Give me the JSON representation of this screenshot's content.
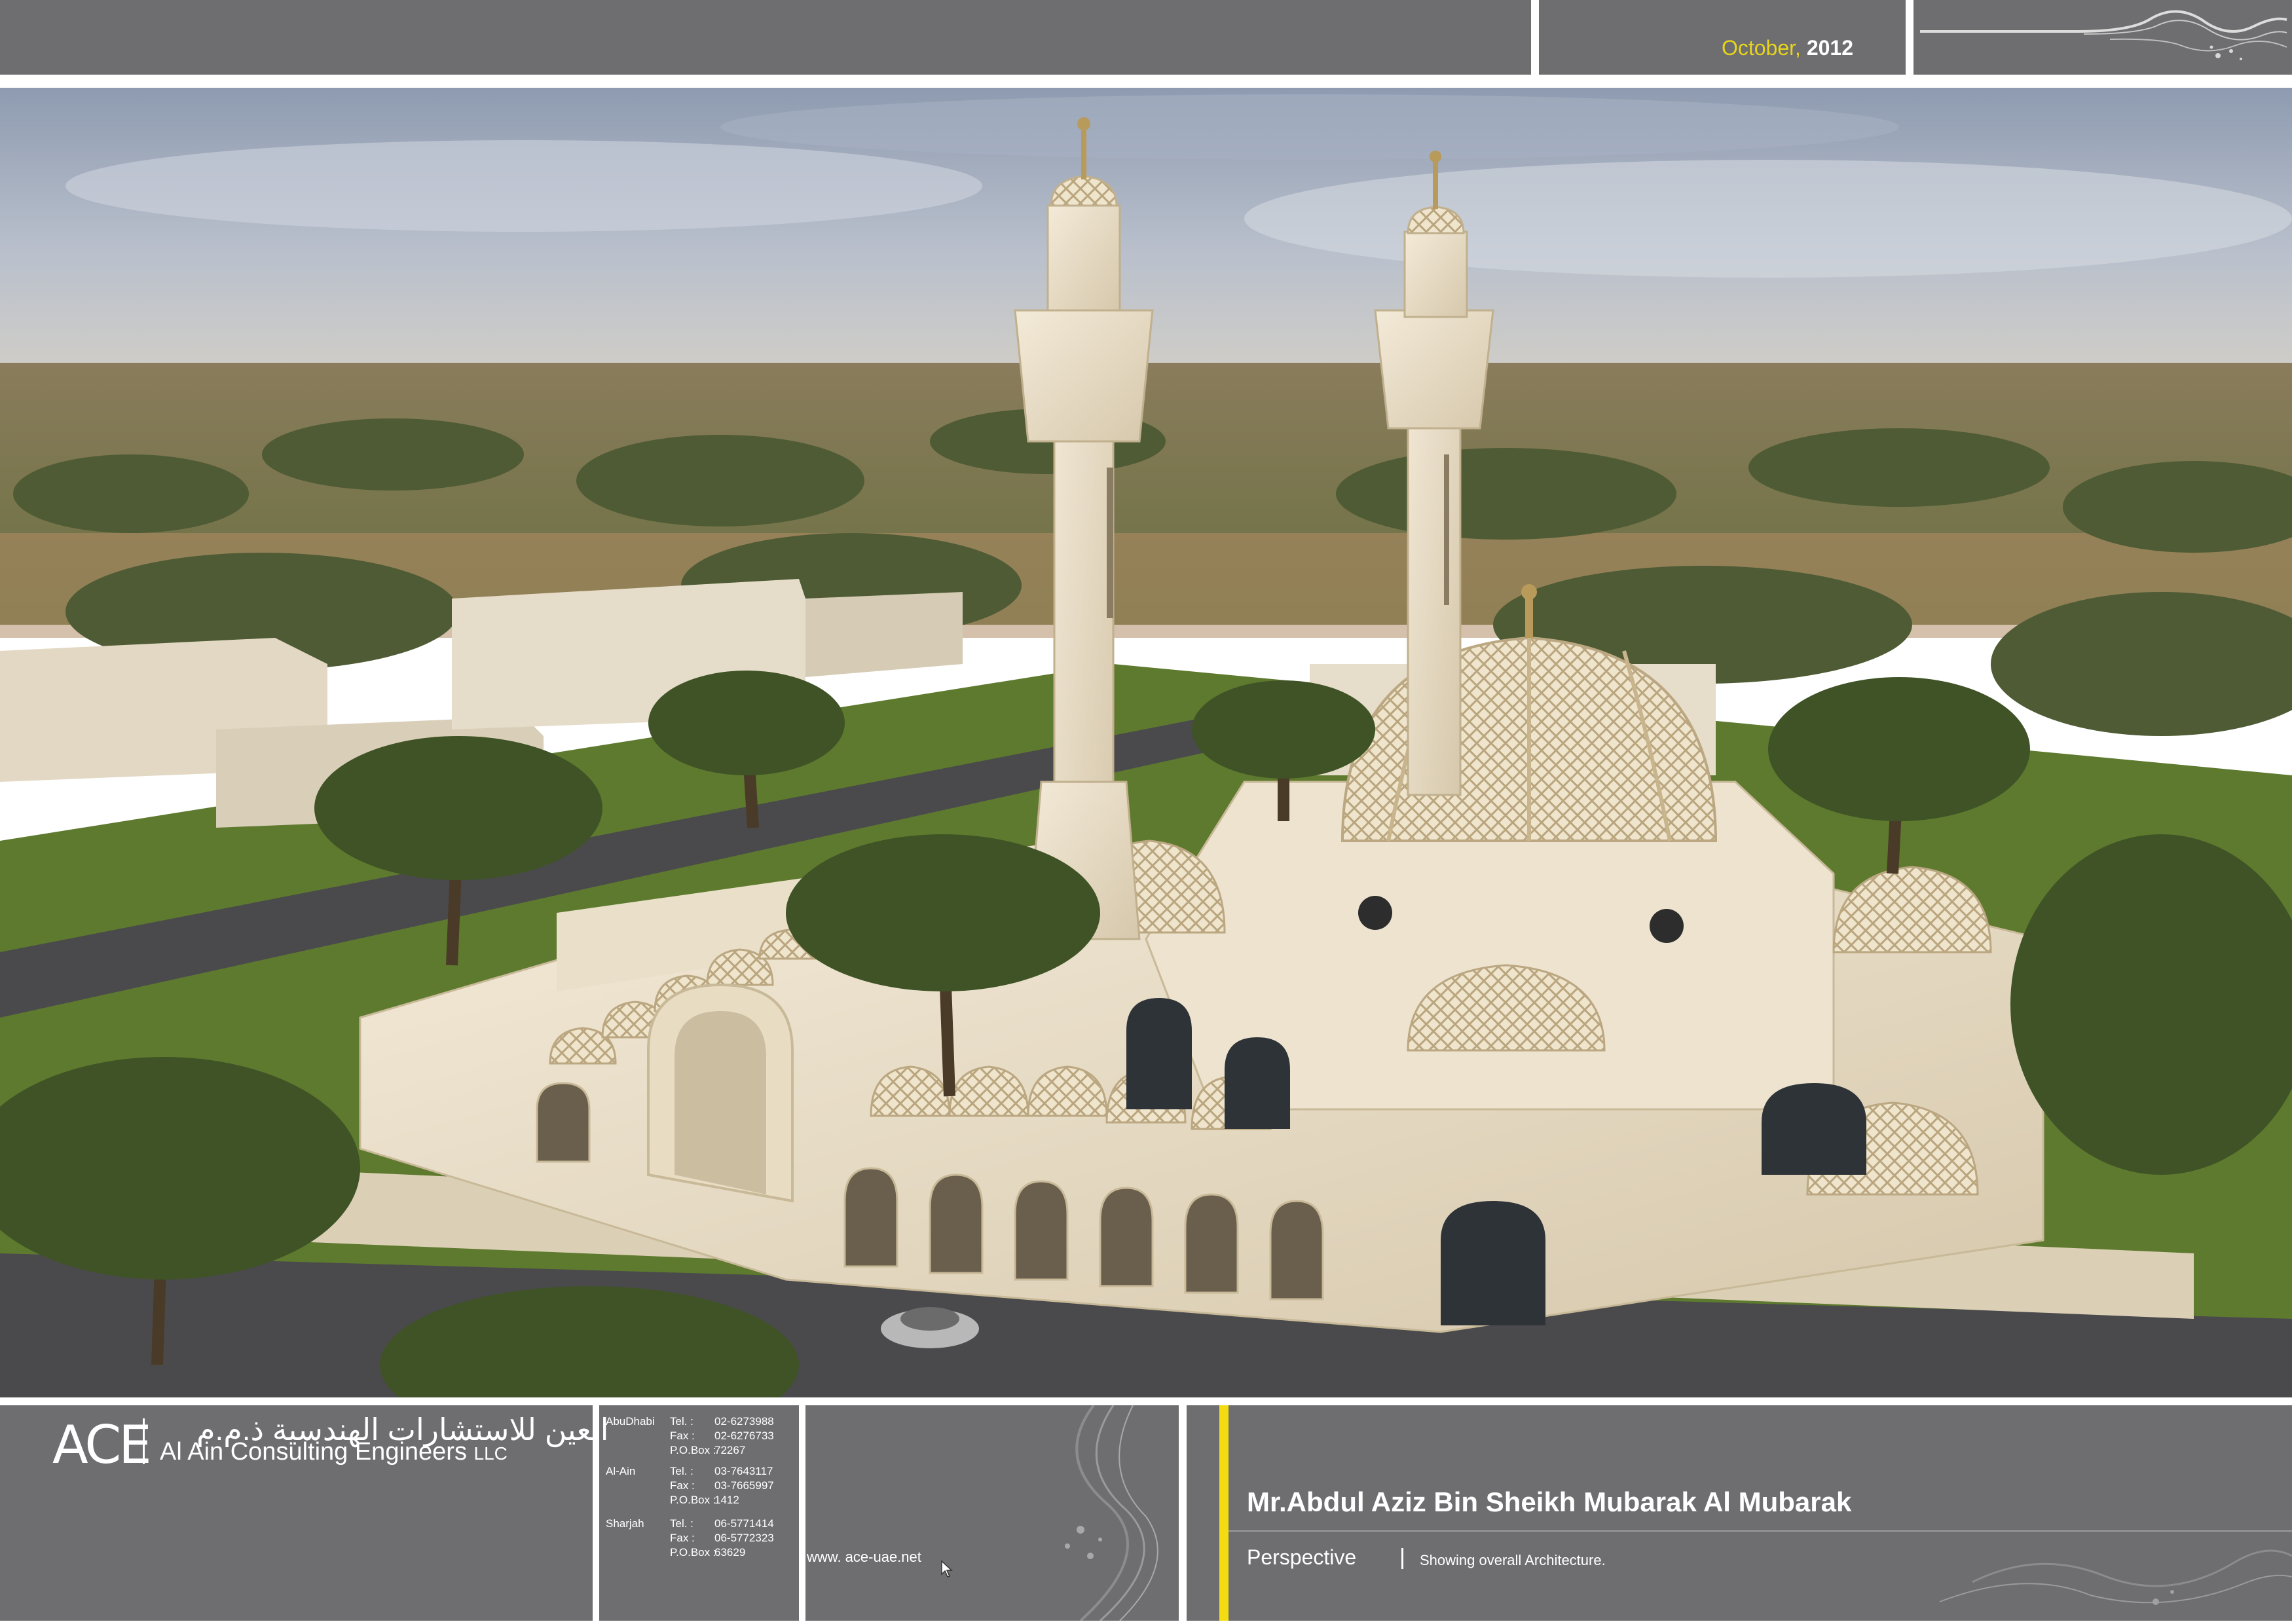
{
  "header": {
    "date_month": "October,",
    "date_year": "2012"
  },
  "colors": {
    "panel": "#6e6e70",
    "accent": "#f4dc12",
    "stone": "#e8dcc4",
    "sky": "#9aa8bb",
    "foliage": "#5a6a3a"
  },
  "rendering": {
    "subject": "mosque-perspective-render"
  },
  "footer": {
    "logo_mark": "ACE",
    "arabic_name": "العين للاستشارات الهندسية ذ.م.م",
    "company_name": "Al Ain Consulting Engineers",
    "company_suffix": "LLC",
    "offices": [
      {
        "city": "AbuDhabi",
        "rows": [
          {
            "label": "Tel.  :",
            "value": "02-6273988"
          },
          {
            "label": "Fax   :",
            "value": "02-6276733"
          },
          {
            "label": "P.O.Box :",
            "value": "72267"
          }
        ]
      },
      {
        "city": "Al-Ain",
        "rows": [
          {
            "label": "Tel.  :",
            "value": "03-7643117"
          },
          {
            "label": "Fax   :",
            "value": "03-7665997"
          },
          {
            "label": "P.O.Box :",
            "value": "1412"
          }
        ]
      },
      {
        "city": "Sharjah",
        "rows": [
          {
            "label": "Tel.  :",
            "value": "06-5771414"
          },
          {
            "label": "Fax   :",
            "value": "06-5772323"
          },
          {
            "label": "P.O.Box :",
            "value": "63629"
          }
        ]
      }
    ],
    "website": "www. ace-uae.net",
    "client": "Mr.Abdul Aziz Bin Sheikh Mubarak Al Mubarak",
    "view_label": "Perspective",
    "view_description": "Showing overall Architecture."
  }
}
